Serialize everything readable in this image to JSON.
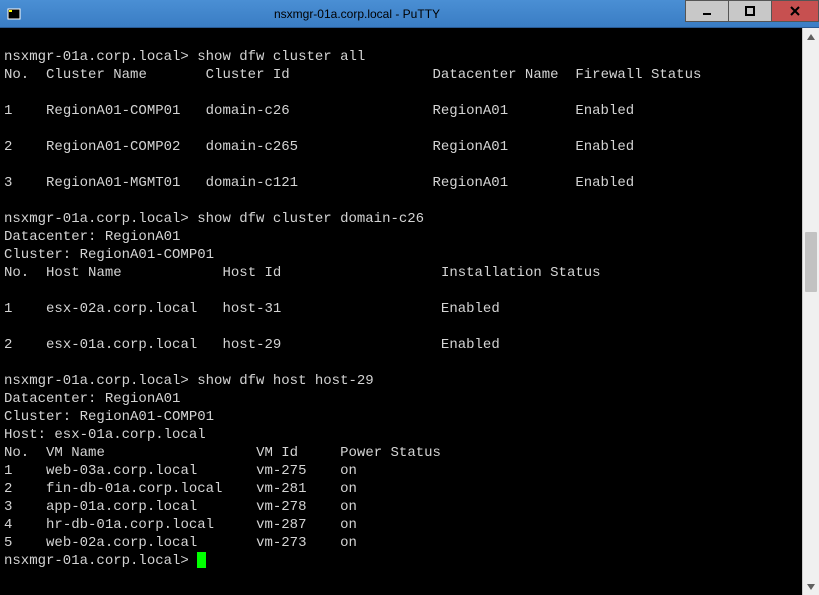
{
  "window": {
    "title": "nsxmgr-01a.corp.local - PuTTY"
  },
  "prompt": "nsxmgr-01a.corp.local>",
  "cmd1": {
    "command": "show dfw cluster all",
    "header": {
      "no": "No.",
      "cluster_name": "Cluster Name",
      "cluster_id": "Cluster Id",
      "datacenter_name": "Datacenter Name",
      "firewall_status": "Firewall Status"
    },
    "rows": [
      {
        "no": "1",
        "cluster_name": "RegionA01-COMP01",
        "cluster_id": "domain-c26",
        "datacenter_name": "RegionA01",
        "firewall_status": "Enabled"
      },
      {
        "no": "2",
        "cluster_name": "RegionA01-COMP02",
        "cluster_id": "domain-c265",
        "datacenter_name": "RegionA01",
        "firewall_status": "Enabled"
      },
      {
        "no": "3",
        "cluster_name": "RegionA01-MGMT01",
        "cluster_id": "domain-c121",
        "datacenter_name": "RegionA01",
        "firewall_status": "Enabled"
      }
    ]
  },
  "cmd2": {
    "command": "show dfw cluster domain-c26",
    "datacenter_line": "Datacenter: RegionA01",
    "cluster_line": "Cluster: RegionA01-COMP01",
    "header": {
      "no": "No.",
      "host_name": "Host Name",
      "host_id": "Host Id",
      "installation_status": "Installation Status"
    },
    "rows": [
      {
        "no": "1",
        "host_name": "esx-02a.corp.local",
        "host_id": "host-31",
        "installation_status": "Enabled"
      },
      {
        "no": "2",
        "host_name": "esx-01a.corp.local",
        "host_id": "host-29",
        "installation_status": "Enabled"
      }
    ]
  },
  "cmd3": {
    "command": "show dfw host host-29",
    "datacenter_line": "Datacenter: RegionA01",
    "cluster_line": "Cluster: RegionA01-COMP01",
    "host_line": "Host: esx-01a.corp.local",
    "header": {
      "no": "No.",
      "vm_name": "VM Name",
      "vm_id": "VM Id",
      "power_status": "Power Status"
    },
    "rows": [
      {
        "no": "1",
        "vm_name": "web-03a.corp.local",
        "vm_id": "vm-275",
        "power_status": "on"
      },
      {
        "no": "2",
        "vm_name": "fin-db-01a.corp.local",
        "vm_id": "vm-281",
        "power_status": "on"
      },
      {
        "no": "3",
        "vm_name": "app-01a.corp.local",
        "vm_id": "vm-278",
        "power_status": "on"
      },
      {
        "no": "4",
        "vm_name": "hr-db-01a.corp.local",
        "vm_id": "vm-287",
        "power_status": "on"
      },
      {
        "no": "5",
        "vm_name": "web-02a.corp.local",
        "vm_id": "vm-273",
        "power_status": "on"
      }
    ]
  }
}
